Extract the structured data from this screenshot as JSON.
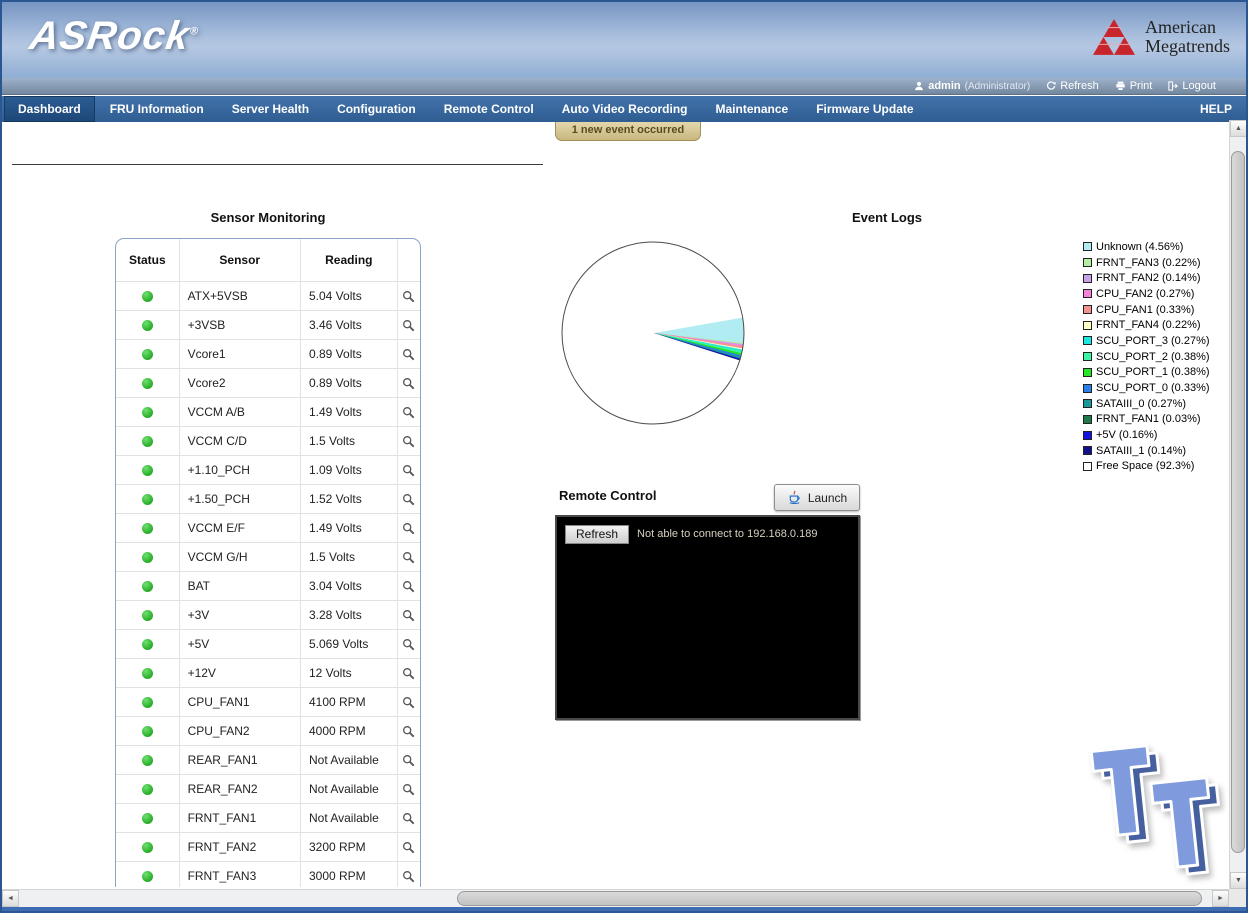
{
  "header": {
    "brand": "ASRock",
    "vendor_line1": "American",
    "vendor_line2": "Megatrends"
  },
  "account_bar": {
    "user": "admin",
    "role": "(Administrator)",
    "refresh_label": "Refresh",
    "print_label": "Print",
    "logout_label": "Logout"
  },
  "nav": {
    "tabs": [
      {
        "label": "Dashboard",
        "active": true
      },
      {
        "label": "FRU Information",
        "active": false
      },
      {
        "label": "Server Health",
        "active": false
      },
      {
        "label": "Configuration",
        "active": false
      },
      {
        "label": "Remote Control",
        "active": false
      },
      {
        "label": "Auto Video Recording",
        "active": false
      },
      {
        "label": "Maintenance",
        "active": false
      },
      {
        "label": "Firmware Update",
        "active": false
      }
    ],
    "help_label": "HELP"
  },
  "notification": {
    "text": "1 new event occurred"
  },
  "sensor_monitoring": {
    "title": "Sensor Monitoring",
    "columns": {
      "status": "Status",
      "sensor": "Sensor",
      "reading": "Reading"
    },
    "rows": [
      {
        "status": "ok",
        "sensor": "ATX+5VSB",
        "reading": "5.04 Volts"
      },
      {
        "status": "ok",
        "sensor": "+3VSB",
        "reading": "3.46 Volts"
      },
      {
        "status": "ok",
        "sensor": "Vcore1",
        "reading": "0.89 Volts"
      },
      {
        "status": "ok",
        "sensor": "Vcore2",
        "reading": "0.89 Volts"
      },
      {
        "status": "ok",
        "sensor": "VCCM A/B",
        "reading": "1.49 Volts"
      },
      {
        "status": "ok",
        "sensor": "VCCM C/D",
        "reading": "1.5 Volts"
      },
      {
        "status": "ok",
        "sensor": "+1.10_PCH",
        "reading": "1.09 Volts"
      },
      {
        "status": "ok",
        "sensor": "+1.50_PCH",
        "reading": "1.52 Volts"
      },
      {
        "status": "ok",
        "sensor": "VCCM E/F",
        "reading": "1.49 Volts"
      },
      {
        "status": "ok",
        "sensor": "VCCM G/H",
        "reading": "1.5 Volts"
      },
      {
        "status": "ok",
        "sensor": "BAT",
        "reading": "3.04 Volts"
      },
      {
        "status": "ok",
        "sensor": "+3V",
        "reading": "3.28 Volts"
      },
      {
        "status": "ok",
        "sensor": "+5V",
        "reading": "5.069 Volts"
      },
      {
        "status": "ok",
        "sensor": "+12V",
        "reading": "12 Volts"
      },
      {
        "status": "ok",
        "sensor": "CPU_FAN1",
        "reading": "4100 RPM"
      },
      {
        "status": "ok",
        "sensor": "CPU_FAN2",
        "reading": "4000 RPM"
      },
      {
        "status": "ok",
        "sensor": "REAR_FAN1",
        "reading": "Not Available"
      },
      {
        "status": "ok",
        "sensor": "REAR_FAN2",
        "reading": "Not Available"
      },
      {
        "status": "ok",
        "sensor": "FRNT_FAN1",
        "reading": "Not Available"
      },
      {
        "status": "ok",
        "sensor": "FRNT_FAN2",
        "reading": "3200 RPM"
      },
      {
        "status": "ok",
        "sensor": "FRNT_FAN3",
        "reading": "3000 RPM"
      }
    ]
  },
  "event_logs": {
    "title": "Event Logs",
    "chart_data": {
      "type": "pie",
      "title": "Event Logs",
      "legend_position": "right",
      "start_angle_deg": -10,
      "slices": [
        {
          "label": "Unknown (4.56%)",
          "value": 4.56,
          "color": "#b0ecf2"
        },
        {
          "label": "FRNT_FAN3 (0.22%)",
          "value": 0.22,
          "color": "#b4eea4"
        },
        {
          "label": "FRNT_FAN2 (0.14%)",
          "value": 0.14,
          "color": "#c8a2e8"
        },
        {
          "label": "CPU_FAN2 (0.27%)",
          "value": 0.27,
          "color": "#f584d8"
        },
        {
          "label": "CPU_FAN1 (0.33%)",
          "value": 0.33,
          "color": "#f49292"
        },
        {
          "label": "FRNT_FAN4 (0.22%)",
          "value": 0.22,
          "color": "#ffffc8"
        },
        {
          "label": "SCU_PORT_3 (0.27%)",
          "value": 0.27,
          "color": "#17e9e1"
        },
        {
          "label": "SCU_PORT_2 (0.38%)",
          "value": 0.38,
          "color": "#3cf5a3"
        },
        {
          "label": "SCU_PORT_1 (0.38%)",
          "value": 0.38,
          "color": "#27e427"
        },
        {
          "label": "SCU_PORT_0 (0.33%)",
          "value": 0.33,
          "color": "#2a7fe8"
        },
        {
          "label": "SATAIII_0 (0.27%)",
          "value": 0.27,
          "color": "#1a9a96"
        },
        {
          "label": "FRNT_FAN1 (0.03%)",
          "value": 0.03,
          "color": "#1f7a4a"
        },
        {
          "label": "+5V (0.16%)",
          "value": 0.16,
          "color": "#1515e0"
        },
        {
          "label": "SATAIII_1 (0.14%)",
          "value": 0.14,
          "color": "#10108a"
        },
        {
          "label": "Free Space (92.3%)",
          "value": 92.3,
          "color": "#ffffff"
        }
      ]
    }
  },
  "remote_control": {
    "title": "Remote Control",
    "launch_label": "Launch",
    "refresh_label": "Refresh",
    "message": "Not able to connect to 192.168.0.189"
  },
  "watermark": {
    "text": "TT"
  }
}
